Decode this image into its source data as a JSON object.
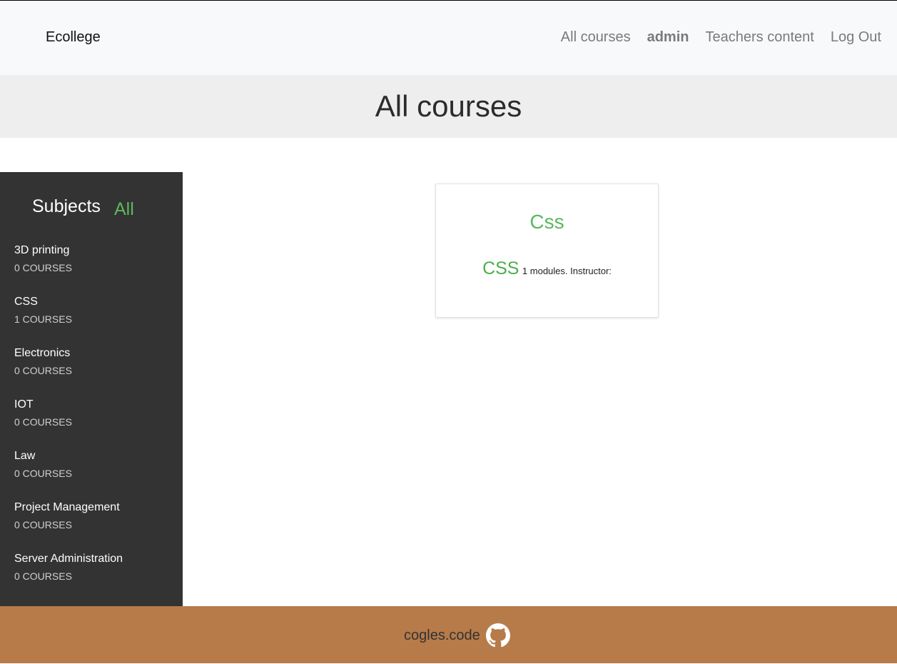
{
  "header": {
    "brand": "Ecollege",
    "nav": [
      {
        "label": "All courses"
      },
      {
        "label": "admin"
      },
      {
        "label": "Teachers content"
      },
      {
        "label": "Log Out"
      }
    ]
  },
  "hero": {
    "title": "All courses"
  },
  "sidebar": {
    "title": "Subjects",
    "all_label": "All",
    "subjects": [
      {
        "name": "3D printing",
        "count": "0 COURSES"
      },
      {
        "name": "CSS",
        "count": "1 COURSES"
      },
      {
        "name": "Electronics",
        "count": "0 COURSES"
      },
      {
        "name": "IOT",
        "count": "0 COURSES"
      },
      {
        "name": "Law",
        "count": "0 COURSES"
      },
      {
        "name": "Project Management",
        "count": "0 COURSES"
      },
      {
        "name": "Server Administration",
        "count": "0 COURSES"
      }
    ]
  },
  "courses": [
    {
      "title": "Css",
      "subject": "CSS",
      "info": "1 modules. Instructor:"
    }
  ],
  "footer": {
    "text": "cogles.code",
    "icon": "github-icon"
  },
  "colors": {
    "accent": "#5cb85c",
    "sidebar_bg": "#333333",
    "footer_bg": "#b77b49",
    "hero_bg": "#eeeeee",
    "navbar_bg": "#f8f9fa"
  }
}
